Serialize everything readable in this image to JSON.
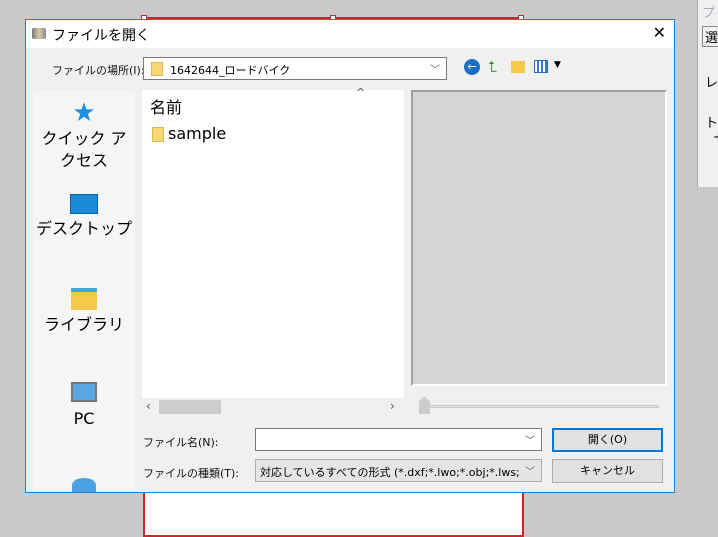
{
  "dialog": {
    "title": "ファイルを開く",
    "close": "✕"
  },
  "location": {
    "label": "ファイルの場所(I):",
    "value": "1642644_ロードバイク"
  },
  "places": [
    {
      "label": "クイック アクセス",
      "icon": "star-icon"
    },
    {
      "label": "デスクトップ",
      "icon": "desktop-icon"
    },
    {
      "label": "ライブラリ",
      "icon": "library-icon"
    },
    {
      "label": "PC",
      "icon": "pc-icon"
    },
    {
      "label": "",
      "icon": "network-icon"
    }
  ],
  "list": {
    "column": "名前",
    "items": [
      {
        "name": "sample"
      }
    ]
  },
  "filename": {
    "label": "ファイル名(N):",
    "value": ""
  },
  "filetype": {
    "label": "ファイルの種類(T):",
    "value": "対応しているすべての形式 (*.dxf;*.lwo;*.obj;*.lws;*.csv"
  },
  "buttons": {
    "open": "開く(O)",
    "cancel": "キャンセル"
  },
  "sidepanel": {
    "title": "プ",
    "tab": "選",
    "row1": "レ",
    "row2": "ト",
    "row3": "+"
  }
}
